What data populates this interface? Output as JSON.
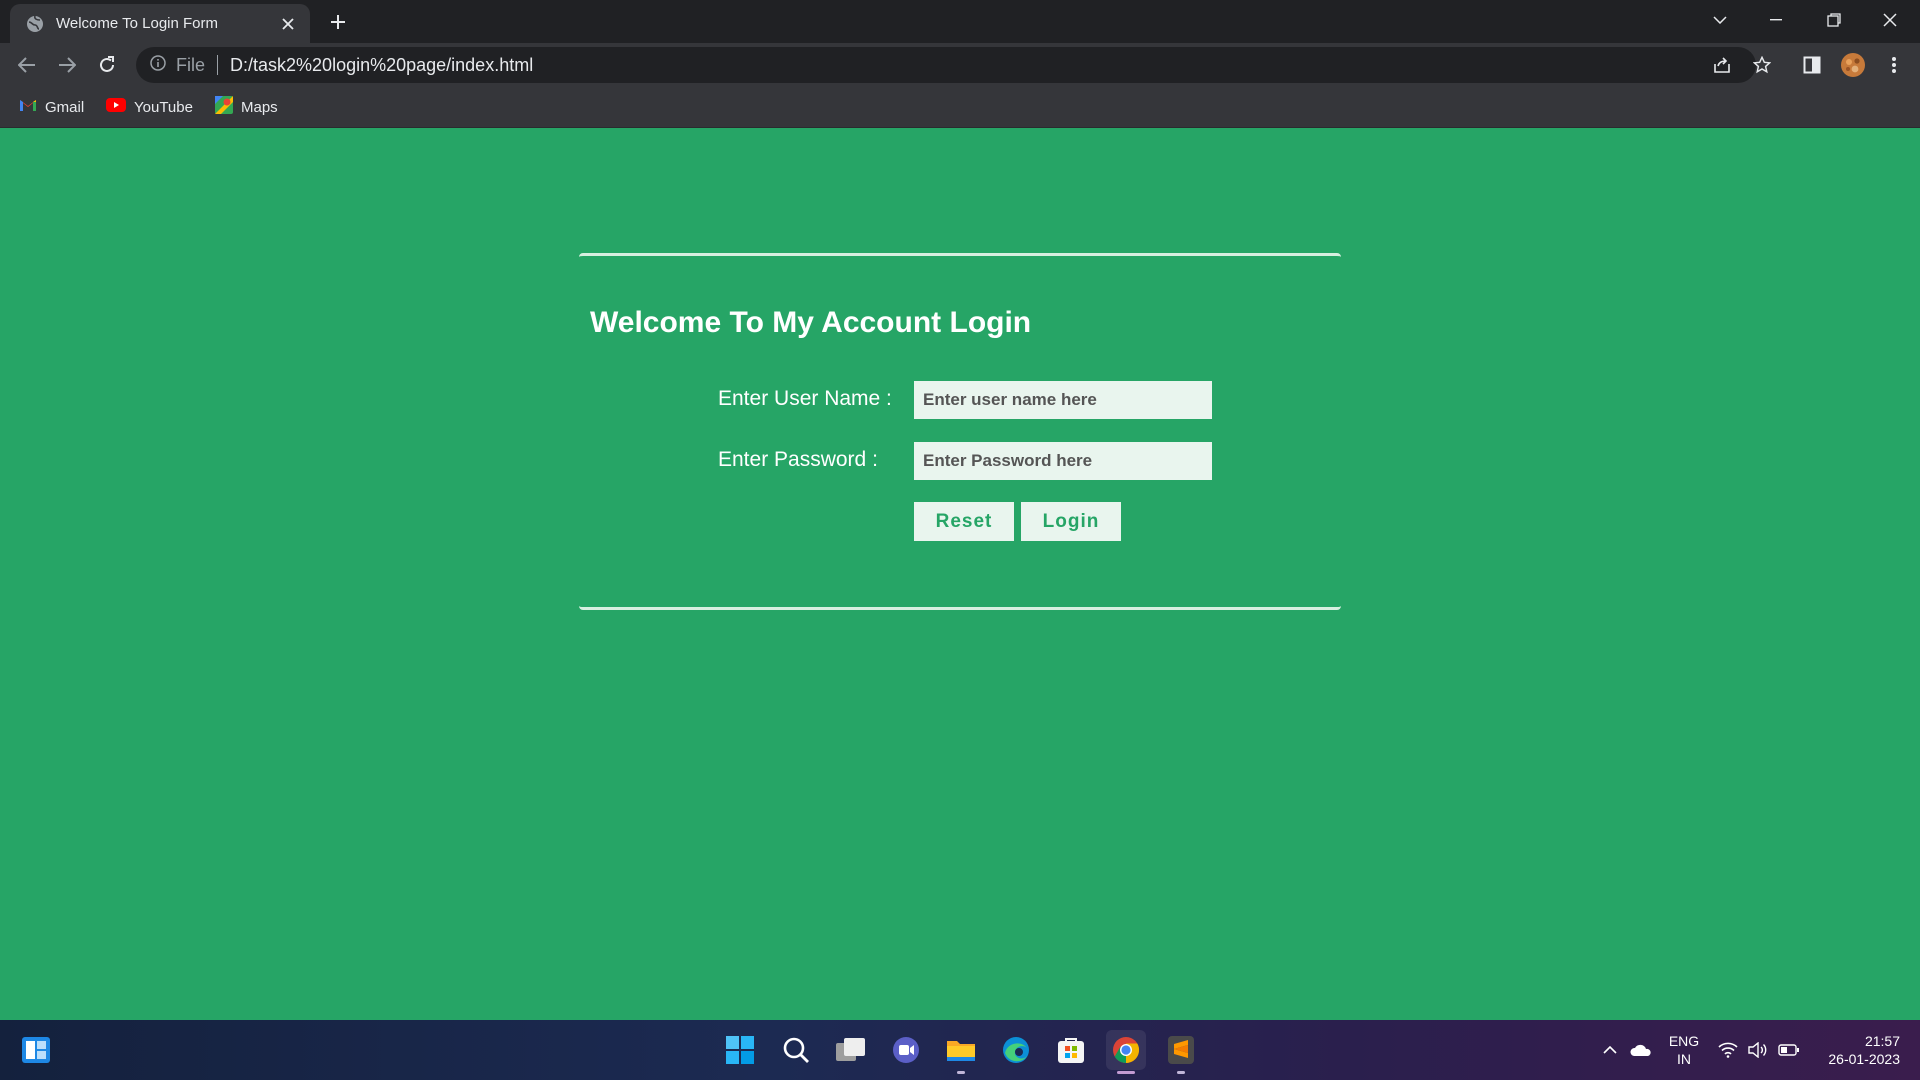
{
  "browser": {
    "tab_title": "Welcome To Login Form",
    "address_scheme_label": "File",
    "url": "D:/task2%20login%20page/index.html",
    "bookmarks": [
      {
        "label": "Gmail",
        "icon": "gmail-icon"
      },
      {
        "label": "YouTube",
        "icon": "youtube-icon"
      },
      {
        "label": "Maps",
        "icon": "maps-icon"
      }
    ]
  },
  "page": {
    "background_color": "#26a566",
    "heading": "Welcome To My Account Login",
    "username": {
      "label": "Enter User Name :",
      "placeholder": "Enter user name here",
      "value": ""
    },
    "password": {
      "label": "Enter Password :",
      "placeholder": "Enter Password here",
      "value": ""
    },
    "reset_label": "Reset",
    "login_label": "Login"
  },
  "taskbar": {
    "language": {
      "line1": "ENG",
      "line2": "IN"
    },
    "time": "21:57",
    "date": "26-01-2023",
    "pinned": [
      "widgets-icon",
      "start-icon",
      "search-icon",
      "task-view-icon",
      "teams-chat-icon",
      "file-explorer-icon",
      "edge-icon",
      "store-icon",
      "chrome-icon",
      "sublime-text-icon"
    ]
  }
}
